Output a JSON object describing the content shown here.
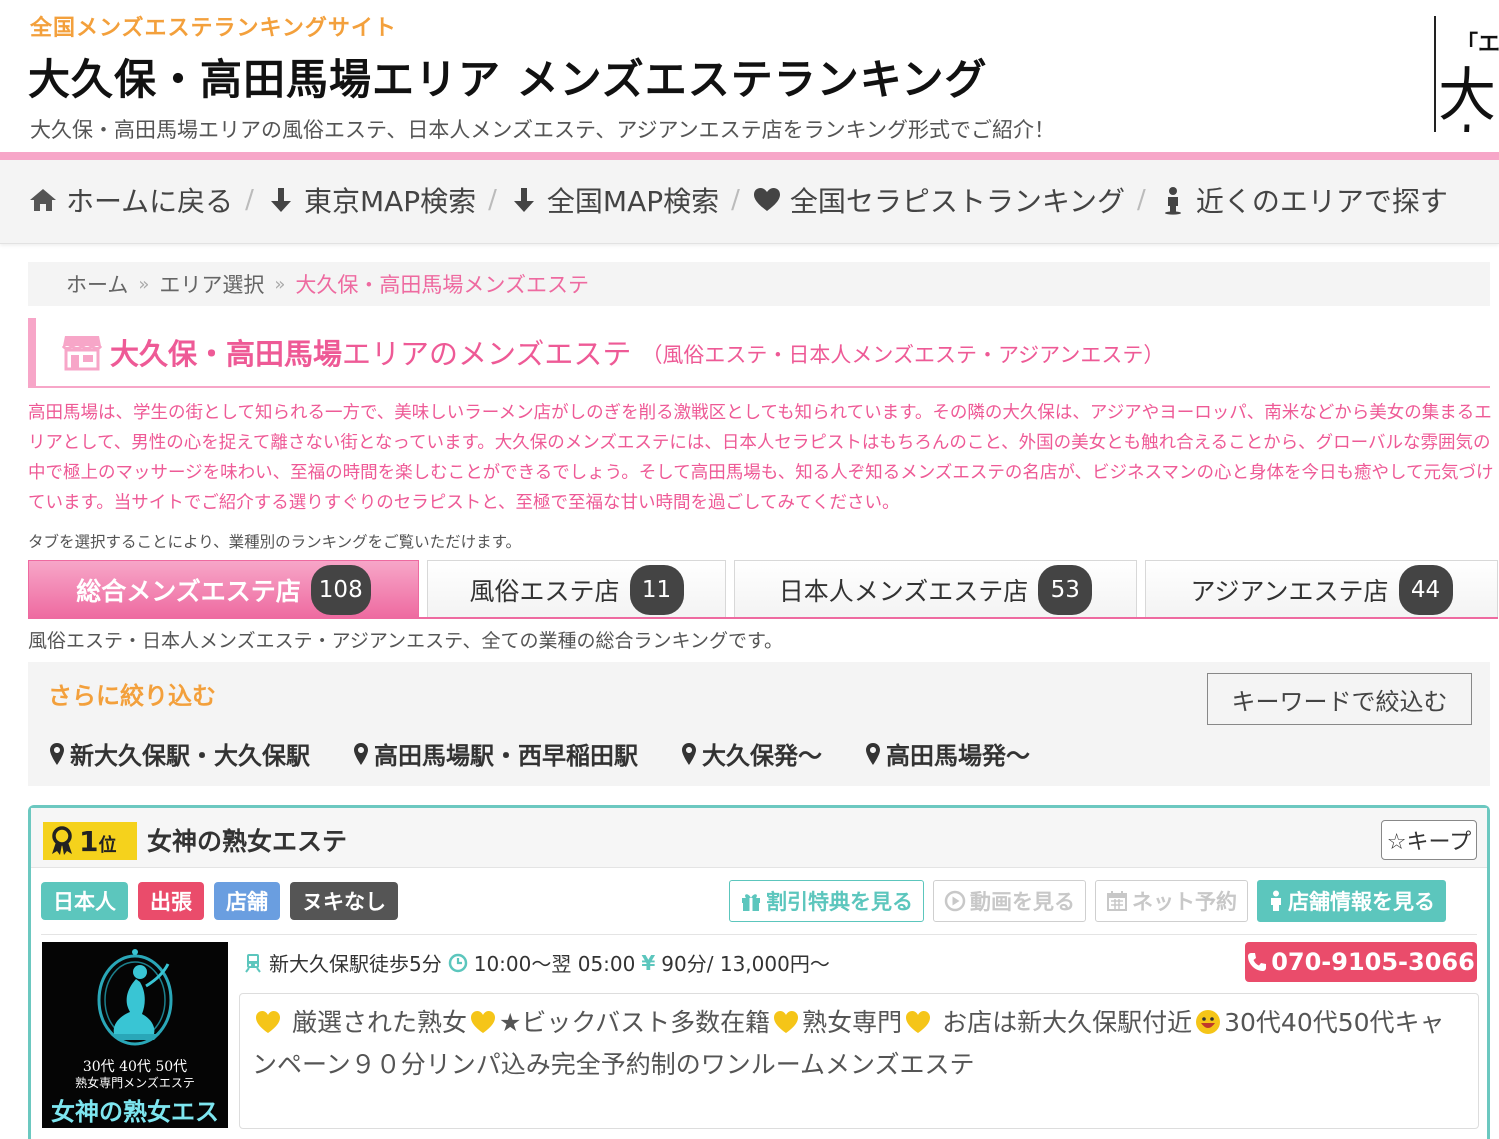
{
  "header": {
    "site_tag": "全国メンズエステランキングサイト",
    "title": "大久保・高田馬場エリア メンズエステランキング",
    "description": "大久保・高田馬場エリアの風俗エステ、日本人メンズエステ、アジアンエステ店をランキング形式でご紹介！",
    "logo_text_small": "「エ",
    "logo_text_large": "大人"
  },
  "nav": {
    "items": [
      {
        "label": "ホームに戻る",
        "icon": "home-icon"
      },
      {
        "label": "東京MAP検索",
        "icon": "arrow-down-icon"
      },
      {
        "label": "全国MAP検索",
        "icon": "arrow-down-icon"
      },
      {
        "label": "全国セラピストランキング",
        "icon": "heart-icon"
      },
      {
        "label": "近くのエリアで探す",
        "icon": "person-icon"
      }
    ],
    "separator": "/"
  },
  "breadcrumb": {
    "items": [
      "ホーム",
      "エリア選択"
    ],
    "current": "大久保・高田馬場メンズエステ",
    "separator": "»"
  },
  "section": {
    "title_bold": "大久保・高田馬場",
    "title_rest": "エリアのメンズエステ",
    "subtitle": "（風俗エステ・日本人メンズエステ・アジアンエステ）",
    "intro": "高田馬場は、学生の街として知られる一方で、美味しいラーメン店がしのぎを削る激戦区としても知られています。その隣の大久保は、アジアやヨーロッパ、南米などから美女の集まるエリアとして、男性の心を捉えて離さない街となっています。大久保のメンズエステには、日本人セラピストはもちろんのこと、外国の美女とも触れ合えることから、グローバルな雰囲気の中で極上のマッサージを味わい、至福の時間を楽しむことができるでしょう。そして高田馬場も、知る人ぞ知るメンズエステの名店が、ビジネスマンの心と身体を今日も癒やして元気づけています。当サイトでご紹介する選りすぐりのセラピストと、至極で至福な甘い時間を過ごしてみてください。",
    "tab_help": "タブを選択することにより、業種別のランキングをご覧いただけます。"
  },
  "tabs": [
    {
      "label": "総合メンズエステ店",
      "count": "108",
      "active": true
    },
    {
      "label": "風俗エステ店",
      "count": "11",
      "active": false
    },
    {
      "label": "日本人メンズエステ店",
      "count": "53",
      "active": false
    },
    {
      "label": "アジアンエステ店",
      "count": "44",
      "active": false
    }
  ],
  "tab_desc": "風俗エステ・日本人メンズエステ・アジアンエステ、全ての業種の総合ランキングです。",
  "filter": {
    "title": "さらに絞り込む",
    "keyword_button": "キーワードで絞込む",
    "links": [
      "新大久保駅・大久保駅",
      "高田馬場駅・西早稲田駅",
      "大久保発～",
      "高田馬場発～"
    ]
  },
  "shop": {
    "rank_number": "1",
    "rank_suffix": "位",
    "name": "女神の熟女エステ",
    "keep_label": "☆キープ",
    "tags": [
      "日本人",
      "出張",
      "店舗",
      "ヌキなし"
    ],
    "actions": {
      "discount": "割引特典を見る",
      "video": "動画を見る",
      "reserve": "ネット予約",
      "info": "店舗情報を見る"
    },
    "access": "新大久保駅徒歩5分",
    "hours": "10:00～翌 05:00",
    "yen_symbol": "¥",
    "price": "90分/ 13,000円～",
    "phone": "070-9105-3066",
    "desc_parts": [
      "厳選された熟女",
      "★ビックバスト多数在籍",
      "熟女専門",
      "お店は新大久保駅付近",
      "30代40代50代キャンペーン９０分リンパ込み完全予約制のワンルームメンズエステ"
    ],
    "thumb": {
      "line1": "30代 40代 50代",
      "line2": "熟女専門メンズエステ",
      "line3": "女神の熟女エステ"
    }
  },
  "colors": {
    "pink": "#ee5a96",
    "pink_light": "#f7a6c8",
    "orange": "#f3a03c",
    "teal": "#5cc6bd",
    "red": "#ea4c6b",
    "blue": "#6a9ee0"
  }
}
